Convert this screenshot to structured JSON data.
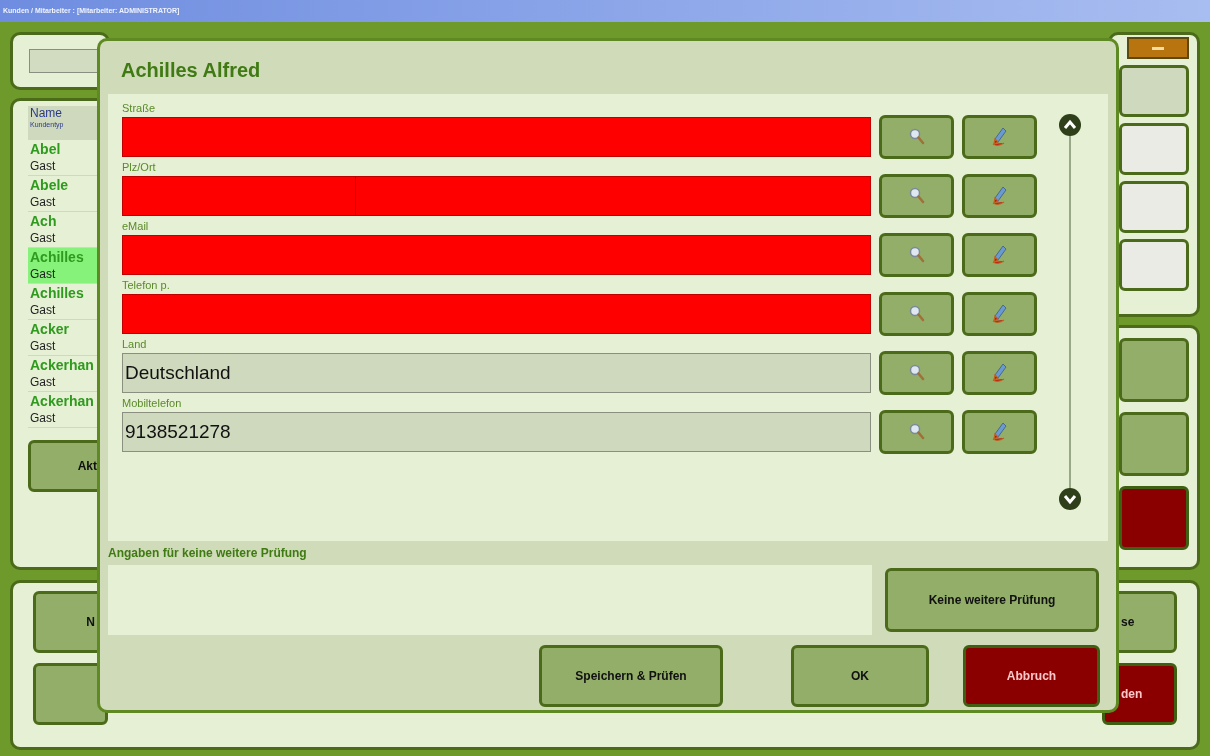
{
  "window": {
    "title": "Kunden / Mitarbeiter : [Mitarbeiter: ADMINISTRATOR]"
  },
  "customer_list": {
    "columns": [
      "Name",
      "Kundentyp"
    ],
    "rows": [
      {
        "name": "Abel",
        "type": "Gast",
        "selected": false
      },
      {
        "name": "Abele",
        "type": "Gast",
        "selected": false
      },
      {
        "name": "Ach",
        "type": "Gast",
        "selected": false
      },
      {
        "name": "Achilles",
        "type": "Gast",
        "selected": true
      },
      {
        "name": "Achilles",
        "type": "Gast",
        "selected": false
      },
      {
        "name": "Acker",
        "type": "Gast",
        "selected": false
      },
      {
        "name": "Ackerhan",
        "type": "Gast",
        "selected": false
      },
      {
        "name": "Ackerhan",
        "type": "Gast",
        "selected": false
      }
    ]
  },
  "list_button": "Akt",
  "bottom_left_button": "N",
  "bottom_right_buttons": [
    {
      "label": "se",
      "kind": "normal"
    },
    {
      "label": "den",
      "kind": "danger"
    }
  ],
  "dialog": {
    "title": "Achilles Alfred",
    "fields": [
      {
        "label": "Straße",
        "kind": "single",
        "invalid": true
      },
      {
        "label": "Plz/Ort",
        "kind": "split",
        "invalid": true
      },
      {
        "label": "eMail",
        "kind": "single",
        "invalid": true
      },
      {
        "label": "Telefon p.",
        "kind": "single",
        "invalid": true
      },
      {
        "label": "Land",
        "kind": "single",
        "invalid": false,
        "value": "Deutschland"
      },
      {
        "label": "Mobiltelefon",
        "kind": "single",
        "invalid": false,
        "value": "9138521278"
      }
    ],
    "note_label": "Angaben für keine weitere Prüfung",
    "note_button": "Keine weitere Prüfung",
    "buttons": [
      {
        "label": "Speichern & Prüfen",
        "kind": "normal"
      },
      {
        "label": "OK",
        "kind": "normal"
      },
      {
        "label": "Abbruch",
        "kind": "danger"
      }
    ]
  }
}
